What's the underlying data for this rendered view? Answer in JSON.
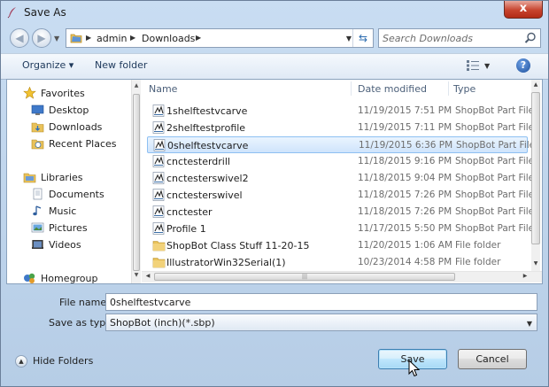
{
  "window": {
    "title": "Save As",
    "close_glyph": "x"
  },
  "navbar": {
    "address": [
      "admin",
      "Downloads"
    ],
    "search_placeholder": "Search Downloads"
  },
  "toolbar": {
    "organize": "Organize ▾",
    "new_folder": "New folder",
    "help": "?"
  },
  "nav": {
    "favorites": "Favorites",
    "desktop": "Desktop",
    "downloads": "Downloads",
    "recent": "Recent Places",
    "libraries": "Libraries",
    "documents": "Documents",
    "music": "Music",
    "pictures": "Pictures",
    "videos": "Videos",
    "homegroup": "Homegroup"
  },
  "columns": {
    "name": "Name",
    "date": "Date modified",
    "type": "Type"
  },
  "files": [
    {
      "name": "1shelftestvcarve",
      "date": "11/19/2015 7:51 PM",
      "type": "ShopBot Part File",
      "kind": "sbp"
    },
    {
      "name": "2shelftestprofile",
      "date": "11/19/2015 7:11 PM",
      "type": "ShopBot Part File",
      "kind": "sbp"
    },
    {
      "name": "0shelftestvcarve",
      "date": "11/19/2015 6:36 PM",
      "type": "ShopBot Part File",
      "kind": "sbp"
    },
    {
      "name": "cnctesterdrill",
      "date": "11/18/2015 9:16 PM",
      "type": "ShopBot Part File",
      "kind": "sbp"
    },
    {
      "name": "cnctesterswivel2",
      "date": "11/18/2015 9:04 PM",
      "type": "ShopBot Part File",
      "kind": "sbp"
    },
    {
      "name": "cnctesterswivel",
      "date": "11/18/2015 7:26 PM",
      "type": "ShopBot Part File",
      "kind": "sbp"
    },
    {
      "name": "cnctester",
      "date": "11/18/2015 7:26 PM",
      "type": "ShopBot Part File",
      "kind": "sbp"
    },
    {
      "name": "Profile 1",
      "date": "11/17/2015 5:50 PM",
      "type": "ShopBot Part File",
      "kind": "sbp"
    },
    {
      "name": "ShopBot Class Stuff 11-20-15",
      "date": "11/20/2015 1:06 AM",
      "type": "File folder",
      "kind": "folder"
    },
    {
      "name": "IllustratorWin32Serial(1)",
      "date": "10/23/2014 4:58 PM",
      "type": "File folder",
      "kind": "folder"
    }
  ],
  "selected_index": 2,
  "form": {
    "file_name_label": "File name:",
    "file_name_value": "0shelftestvcarve",
    "save_as_type_label": "Save as type:",
    "save_as_type_value": "ShopBot (inch)(*.sbp)"
  },
  "footer": {
    "hide_folders": "Hide Folders",
    "save": "Save",
    "cancel": "Cancel"
  },
  "colors": {
    "accent": "#3c7fb1",
    "selection": "#cfe4fc",
    "chrome": "#c9ddf2"
  }
}
